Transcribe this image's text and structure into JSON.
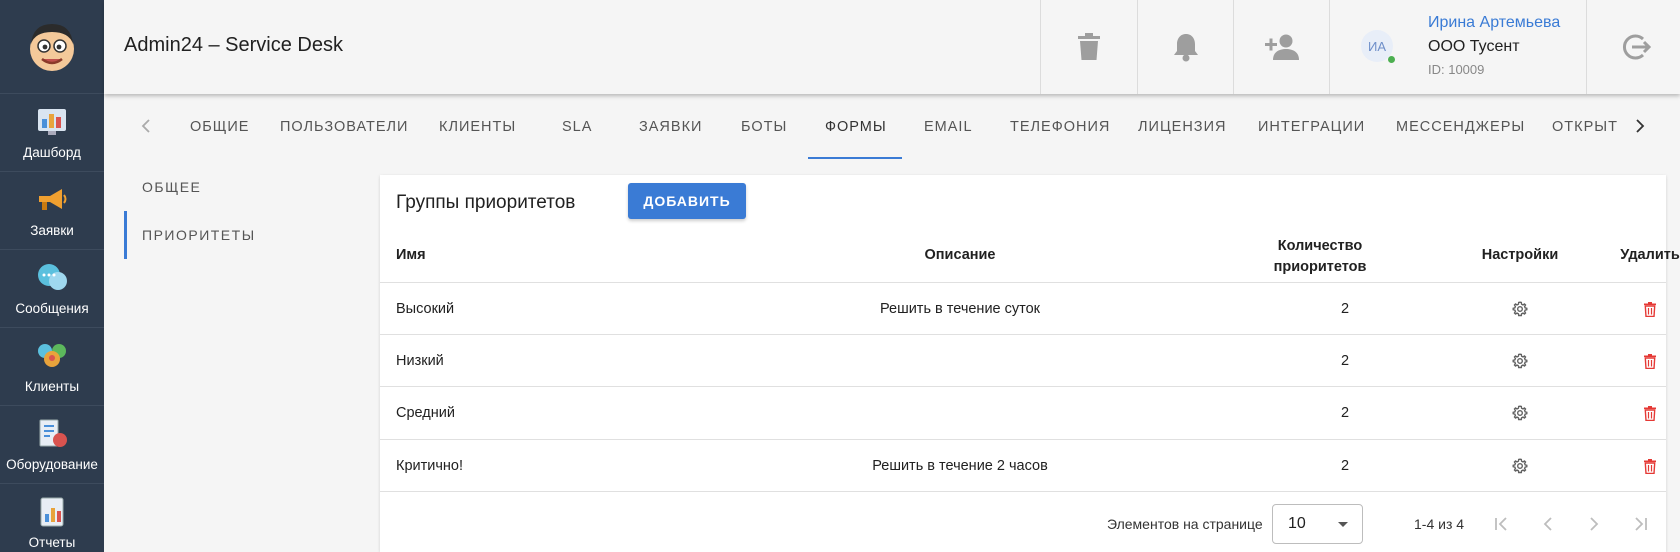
{
  "header": {
    "title": "Admin24 – Service Desk",
    "user": {
      "name": "Ирина Артемьева",
      "org": "ООО Тусент",
      "id_label": "ID: 10009",
      "initials": "ИА"
    }
  },
  "sidebar": {
    "items": [
      {
        "label": "Дашборд",
        "icon": "dashboard-icon"
      },
      {
        "label": "Заявки",
        "icon": "megaphone-icon"
      },
      {
        "label": "Сообщения",
        "icon": "chat-bubbles-icon"
      },
      {
        "label": "Клиенты",
        "icon": "clients-icon"
      },
      {
        "label": "Оборудование",
        "icon": "equipment-icon"
      },
      {
        "label": "Отчеты",
        "icon": "reports-icon"
      }
    ]
  },
  "tabs": [
    {
      "label": "Общие"
    },
    {
      "label": "Пользователи"
    },
    {
      "label": "Клиенты"
    },
    {
      "label": "SLA"
    },
    {
      "label": "Заявки"
    },
    {
      "label": "Боты"
    },
    {
      "label": "Формы",
      "active": true
    },
    {
      "label": "Email"
    },
    {
      "label": "Телефония"
    },
    {
      "label": "Лицензия"
    },
    {
      "label": "Интеграции"
    },
    {
      "label": "Мессенджеры"
    },
    {
      "label": "Открыт"
    }
  ],
  "subnav": {
    "items": [
      {
        "label": "Общее"
      },
      {
        "label": "Приоритеты",
        "active": true
      }
    ]
  },
  "card": {
    "title": "Группы приоритетов",
    "add_label": "Добавить",
    "columns": {
      "name": "Имя",
      "description": "Описание",
      "count_line1": "Количество",
      "count_line2": "приоритетов",
      "settings": "Настройки",
      "delete": "Удалить"
    },
    "rows": [
      {
        "name": "Высокий",
        "description": "Решить в течение суток",
        "count": "2"
      },
      {
        "name": "Низкий",
        "description": "",
        "count": "2"
      },
      {
        "name": "Средний",
        "description": "",
        "count": "2"
      },
      {
        "name": "Критично!",
        "description": "Решить в течение 2 часов",
        "count": "2"
      }
    ],
    "pagination": {
      "per_page_label": "Элементов на странице",
      "per_page_value": "10",
      "range": "1-4 из 4"
    }
  },
  "colors": {
    "sidebar_bg": "#2e3c4e",
    "accent": "#3a7bd5",
    "delete_red": "#e53935"
  }
}
